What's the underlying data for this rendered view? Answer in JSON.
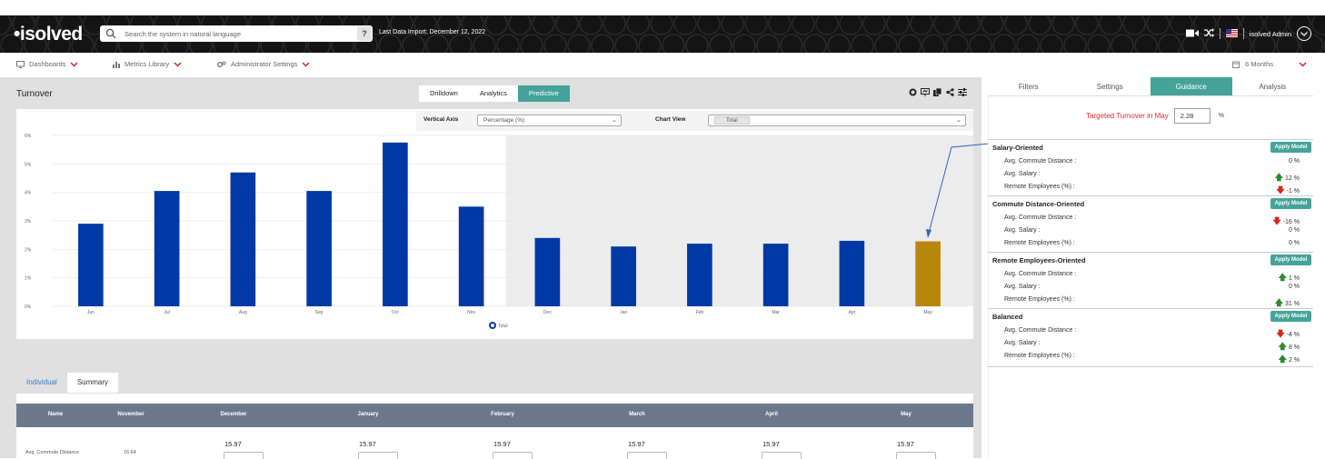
{
  "app": {
    "logo": "isolved",
    "search_placeholder": "Search the system in natural language",
    "help": "?",
    "last_import": "Last Data Import: December 12, 2022",
    "user": "isolved Admin"
  },
  "nav": {
    "dashboards": "Dashboards",
    "metrics": "Metrics Library",
    "admin": "Administrator Settings",
    "period": "6 Months"
  },
  "panel": {
    "title": "Turnover",
    "tabs": [
      "Drilldown",
      "Analytics",
      "Predictive"
    ],
    "active_tab": "Predictive",
    "vertical_axis_label": "Vertical Axis",
    "vertical_axis_value": "Percentage (%)",
    "chart_view_label": "Chart View",
    "chart_view_value": "Total"
  },
  "chart_data": {
    "type": "bar",
    "categories": [
      "Jun",
      "Jul",
      "Aug",
      "Sep",
      "Oct",
      "Nov",
      "Dec",
      "Jan",
      "Feb",
      "Mar",
      "Apr",
      "May"
    ],
    "series": [
      {
        "name": "Total",
        "values": [
          2.9,
          4.05,
          4.7,
          4.05,
          5.75,
          3.5,
          2.4,
          2.1,
          2.2,
          2.2,
          2.3,
          2.28
        ]
      }
    ],
    "yticks": [
      "0%",
      "1%",
      "2%",
      "3%",
      "4%",
      "5%",
      "6%"
    ],
    "ylim": [
      0,
      6
    ],
    "predicted_from": "Dec",
    "highlight": "May",
    "colors": {
      "bar": "#0039a6",
      "highlight": "#b8860b",
      "predicted_bg": "#ececec"
    },
    "legend": "Total",
    "legend_position": "bottom-center",
    "grid": true
  },
  "bottom": {
    "tabs": [
      "Individual",
      "Summary"
    ],
    "active_tab": "Summary",
    "columns": [
      "Name",
      "November",
      "December",
      "January",
      "February",
      "March",
      "April",
      "May"
    ],
    "row": {
      "name": "Avg. Commute Distance",
      "november": "16.64",
      "values": [
        "15.97",
        "15.97",
        "15.97",
        "15.97",
        "15.97",
        "15.97"
      ]
    }
  },
  "guidance": {
    "tabs": [
      "Filters",
      "Settings",
      "Guidance",
      "Analysis"
    ],
    "active_tab": "Guidance",
    "target_label": "Targeted Turnover in May",
    "target_value": "2.28",
    "target_unit": "%",
    "apply_label": "Apply Model",
    "models": [
      {
        "title": "Salary-Oriented",
        "metrics": [
          {
            "label": "Avg. Commute Distance :",
            "value": "0 %",
            "dir": "none"
          },
          {
            "label": "Avg. Salary :",
            "value": "12 %",
            "dir": "up"
          },
          {
            "label": "Remote Employees (%) :",
            "value": "-1 %",
            "dir": "down"
          }
        ]
      },
      {
        "title": "Commute Distance-Oriented",
        "metrics": [
          {
            "label": "Avg. Commute Distance :",
            "value": "-16 %",
            "dir": "down"
          },
          {
            "label": "Avg. Salary :",
            "value": "0 %",
            "dir": "none"
          },
          {
            "label": "Remote Employees (%) :",
            "value": "0 %",
            "dir": "none"
          }
        ]
      },
      {
        "title": "Remote Employees-Oriented",
        "metrics": [
          {
            "label": "Avg. Commute Distance :",
            "value": "1 %",
            "dir": "up"
          },
          {
            "label": "Avg. Salary :",
            "value": "0 %",
            "dir": "none"
          },
          {
            "label": "Remote Employees (%) :",
            "value": "31 %",
            "dir": "up"
          }
        ]
      },
      {
        "title": "Balanced",
        "metrics": [
          {
            "label": "Avg. Commute Distance :",
            "value": "-4 %",
            "dir": "down"
          },
          {
            "label": "Avg. Salary :",
            "value": "8 %",
            "dir": "up"
          },
          {
            "label": "Remote Employees (%) :",
            "value": "2 %",
            "dir": "up"
          }
        ]
      }
    ]
  }
}
